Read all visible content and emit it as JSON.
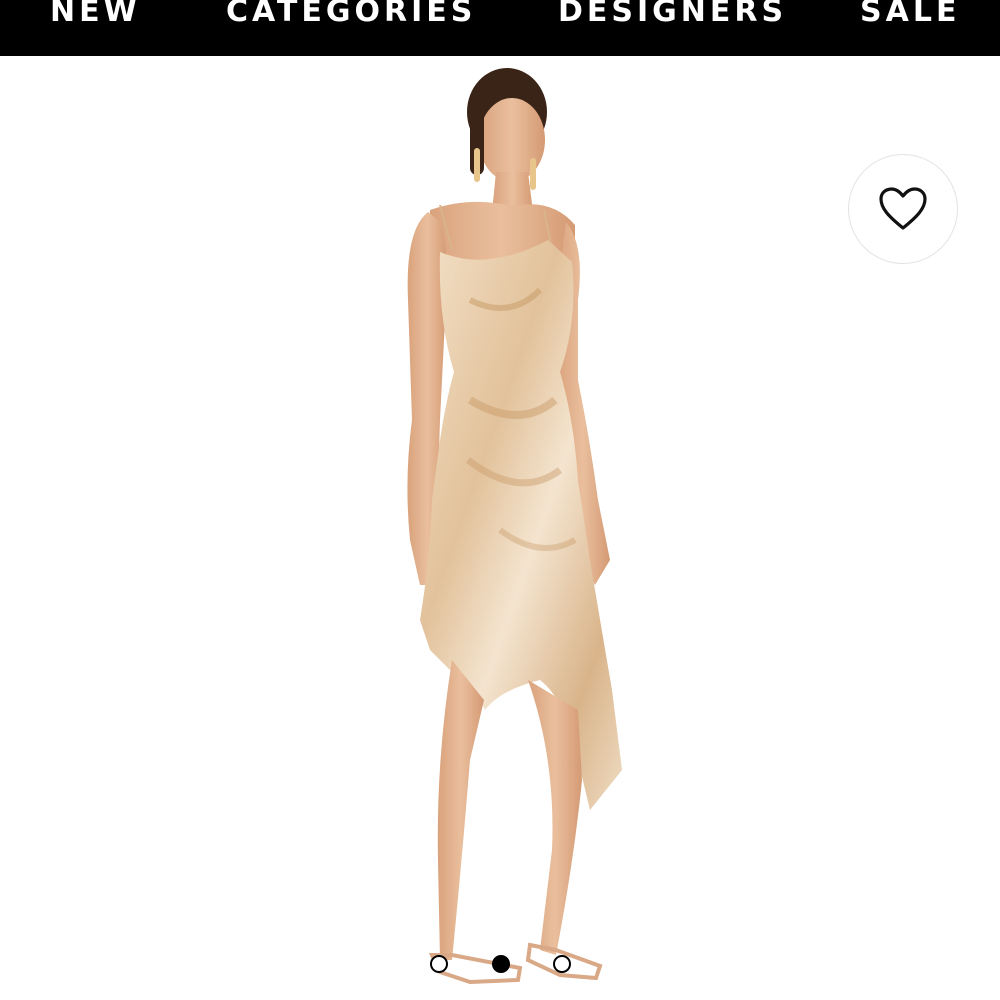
{
  "nav": {
    "items": [
      {
        "label": "NEW"
      },
      {
        "label": "CATEGORIES"
      },
      {
        "label": "DESIGNERS"
      },
      {
        "label": "SALE"
      }
    ]
  },
  "product": {
    "image_subject": "model wearing champagne satin cowl-neck asymmetric wrap midi dress with strappy heels",
    "colors": {
      "dress": "#e9cfaf",
      "skin": "#e4b592",
      "hair": "#3a2417"
    }
  },
  "wishlist": {
    "icon": "heart-outline-icon"
  },
  "carousel": {
    "total_slides": 3,
    "active_slide": 2
  },
  "colors": {
    "nav_background": "#000000",
    "nav_text": "#ffffff",
    "page_background": "#ffffff"
  }
}
